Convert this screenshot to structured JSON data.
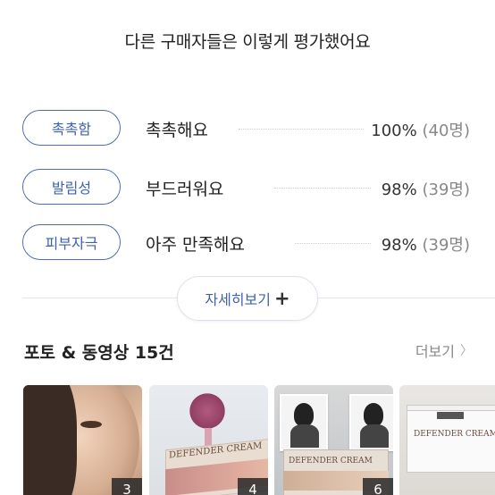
{
  "reviews": {
    "title": "다른 구매자들은 이렇게 평가했어요",
    "items": [
      {
        "tag": "촉촉함",
        "text": "촉촉해요",
        "percent": "100%",
        "count": "(40명)"
      },
      {
        "tag": "발림성",
        "text": "부드러워요",
        "percent": "98%",
        "count": "(39명)"
      },
      {
        "tag": "피부자극",
        "text": "아주 만족해요",
        "percent": "98%",
        "count": "(39명)"
      }
    ],
    "more_label": "자세히보기",
    "more_icon": "plus-icon"
  },
  "media": {
    "title": "포토 & 동영상 15건",
    "more_label": "더보기",
    "more_icon": "chevron-right-icon",
    "thumbnails": [
      {
        "badge": "3"
      },
      {
        "badge": "4",
        "product_text": "DEFENDER CREAM"
      },
      {
        "badge": "6",
        "product_text": "DEFENDER CREAM"
      },
      {
        "badge": "",
        "product_text": "DEFENDER CREAM"
      }
    ]
  },
  "colors": {
    "accent": "#3f63a8",
    "chip_border": "#4a6fb0",
    "muted": "#888888"
  }
}
